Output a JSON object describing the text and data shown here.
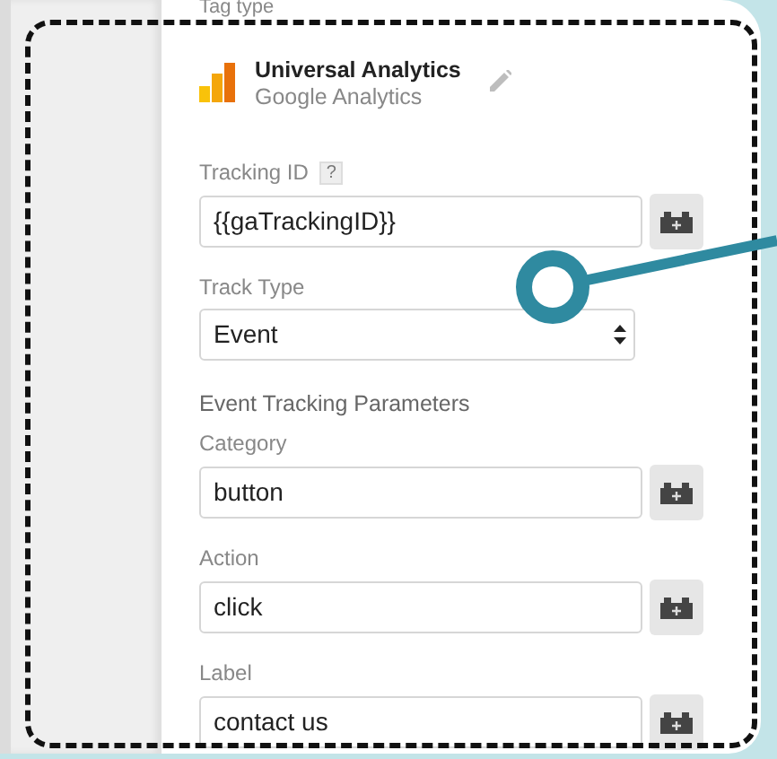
{
  "tag_type": {
    "label": "Tag type",
    "name": "Universal Analytics",
    "vendor": "Google Analytics"
  },
  "fields": [
    {
      "kind": "input",
      "label": "Tracking ID",
      "help": "?",
      "value": "{{gaTrackingID}}"
    },
    {
      "kind": "select",
      "label": "Track Type",
      "value": "Event"
    },
    {
      "kind": "heading",
      "label": "Event Tracking Parameters"
    },
    {
      "kind": "input",
      "label": "Category",
      "value": "button"
    },
    {
      "kind": "input",
      "label": "Action",
      "value": "click"
    },
    {
      "kind": "input",
      "label": "Label",
      "value": "contact us"
    }
  ]
}
